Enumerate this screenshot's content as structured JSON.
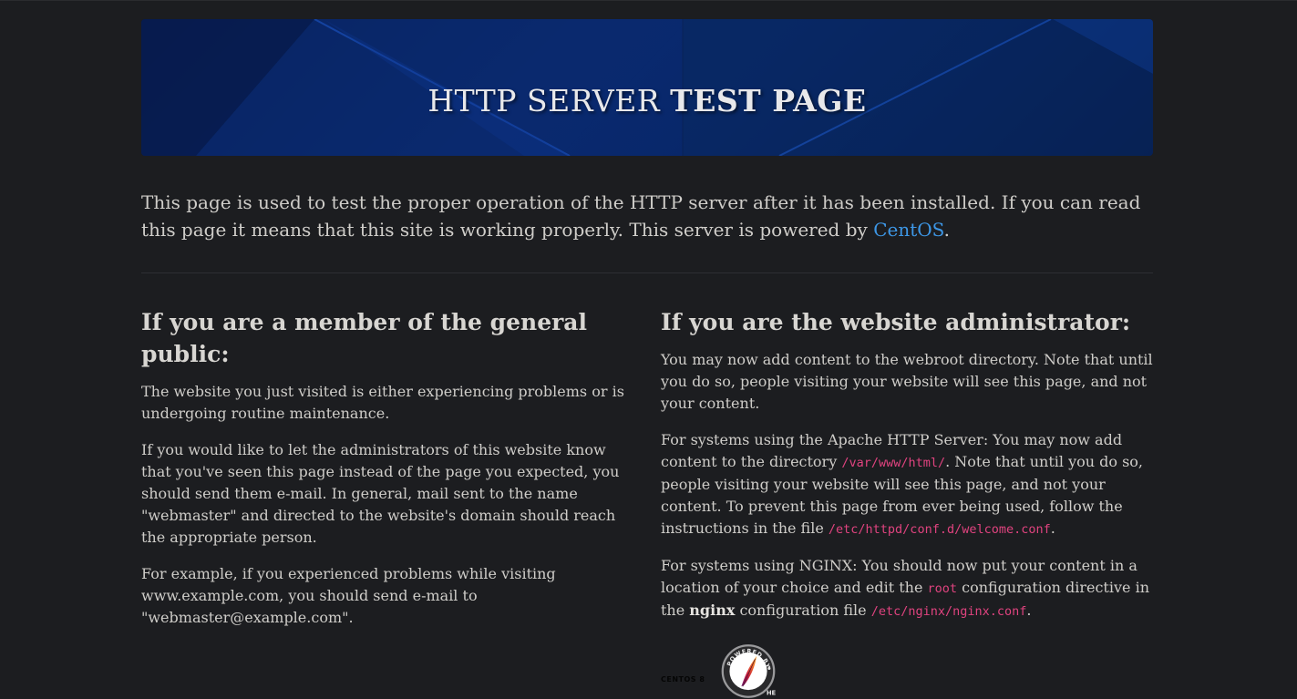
{
  "banner": {
    "title_light": "HTTP SERVER",
    "title_bold": "TEST PAGE"
  },
  "intro": {
    "text": "This page is used to test the proper operation of the HTTP server after it has been installed. If you can read this page it means that this site is working properly. This server is powered by ",
    "link_label": "CentOS",
    "end": "."
  },
  "public_section": {
    "heading": "If you are a member of the general public:",
    "p1": "The website you just visited is either experiencing problems or is undergoing routine maintenance.",
    "p2": "If you would like to let the administrators of this website know that you've seen this page instead of the page you expected, you should send them e-mail. In general, mail sent to the name \"webmaster\" and directed to the website's domain should reach the appropriate person.",
    "p3": "For example, if you experienced problems while visiting www.example.com, you should send e-mail to \"webmaster@example.com\"."
  },
  "admin_section": {
    "heading": "If you are the website administrator:",
    "p1": "You may now add content to the webroot directory. Note that until you do so, people visiting your website will see this page, and not your content.",
    "p2_a": "For systems using the Apache HTTP Server: You may now add content to the directory ",
    "p2_code1": "/var/www/html/",
    "p2_b": ". Note that until you do so, people visiting your website will see this page, and not your content. To prevent this page from ever being used, follow the instructions in the file ",
    "p2_code2": "/etc/httpd/conf.d/welcome.conf",
    "p2_c": ".",
    "p3_a": "For systems using NGINX: You should now put your content in a location of your choice and edit the ",
    "p3_code1": "root",
    "p3_b": " configuration directive in the ",
    "p3_bold": "nginx",
    "p3_c": " configuration file ",
    "p3_code2": "/etc/nginx/nginx.conf",
    "p3_d": "."
  },
  "badges": {
    "centos_label": "CENTOS 8",
    "apache_ring_text": "POWERED BY",
    "apache_ring_text_2": "HE"
  },
  "colors": {
    "background": "#1c1d20",
    "link": "#3d97e6",
    "code": "#e0437f",
    "banner": "#0a2a70"
  }
}
